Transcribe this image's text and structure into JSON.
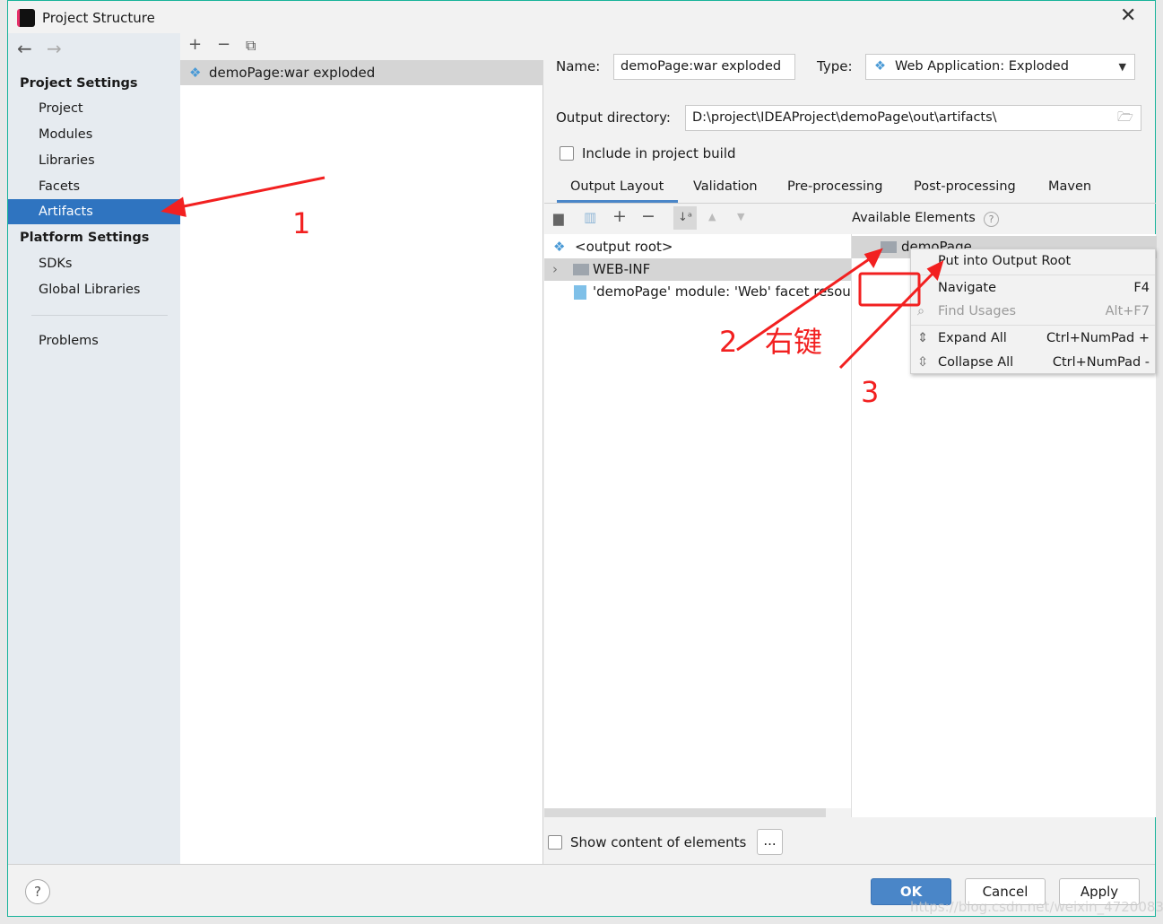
{
  "window": {
    "title": "Project Structure",
    "close_icon": "close-icon",
    "border_color": "#17b39a"
  },
  "sidebar": {
    "groups": [
      {
        "label": "Project Settings",
        "items": [
          {
            "label": "Project"
          },
          {
            "label": "Modules"
          },
          {
            "label": "Libraries"
          },
          {
            "label": "Facets"
          },
          {
            "label": "Artifacts",
            "selected": true
          }
        ]
      },
      {
        "label": "Platform Settings",
        "items": [
          {
            "label": "SDKs"
          },
          {
            "label": "Global Libraries"
          }
        ]
      }
    ],
    "problems": "Problems",
    "selected_color": "#2f74c0"
  },
  "artifacts_list": {
    "items": [
      {
        "label": "demoPage:war exploded",
        "selected": true
      }
    ]
  },
  "details": {
    "name_label": "Name:",
    "name_value": "demoPage:war exploded",
    "type_label": "Type:",
    "type_value": "Web Application: Exploded",
    "output_dir_label": "Output directory:",
    "output_dir_value": "D:\\project\\IDEAProject\\demoPage\\out\\artifacts\\",
    "include_build_label": "Include in project build",
    "include_build_checked": false,
    "tabs": [
      {
        "label": "Output Layout",
        "active": true
      },
      {
        "label": "Validation"
      },
      {
        "label": "Pre-processing"
      },
      {
        "label": "Post-processing"
      },
      {
        "label": "Maven"
      }
    ],
    "available_label": "Available Elements",
    "output_tree": [
      {
        "label": "<output root>"
      },
      {
        "label": "WEB-INF",
        "selected": true
      },
      {
        "label": "'demoPage' module: 'Web' facet resour"
      }
    ],
    "available_tree": [
      {
        "label": "demoPage",
        "selected": true
      }
    ],
    "show_content_label": "Show content of elements",
    "show_content_checked": false,
    "more_button": "..."
  },
  "context_menu": [
    {
      "label": "Put into Output Root",
      "shortcut": ""
    },
    {
      "label": "Navigate",
      "shortcut": "F4"
    },
    {
      "label": "Find Usages",
      "shortcut": "Alt+F7",
      "disabled": true
    },
    {
      "label": "Expand All",
      "shortcut": "Ctrl+NumPad +"
    },
    {
      "label": "Collapse All",
      "shortcut": "Ctrl+NumPad -"
    }
  ],
  "footer": {
    "ok": "OK",
    "cancel": "Cancel",
    "apply": "Apply",
    "help": "?"
  },
  "annotations": {
    "step1": "1",
    "step2": "2",
    "step2_text": "右键",
    "step3": "3",
    "color": "#f22020"
  },
  "watermark": "https://blog.csdn.net/weixin_47200837"
}
